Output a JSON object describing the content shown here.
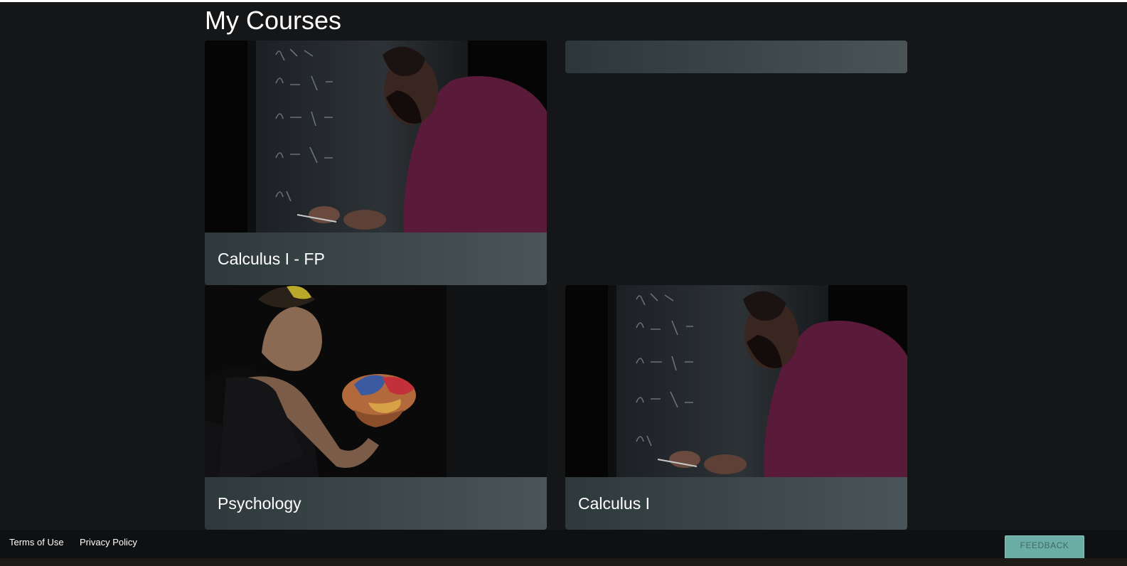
{
  "page": {
    "title": "My Courses"
  },
  "courses": [
    {
      "title": "Calculus I - FP",
      "image": "math-chalkboard-instructor"
    },
    {
      "title": "Psychology",
      "image": "student-holding-brain-model"
    },
    {
      "title": "Calculus I",
      "image": "math-chalkboard-instructor"
    }
  ],
  "footer": {
    "terms_label": "Terms of Use",
    "privacy_label": "Privacy Policy",
    "feedback_label": "FEEDBACK"
  },
  "colors": {
    "background": "#151618",
    "card_footer_start": "#2e393c",
    "card_footer_end": "#4a5558",
    "feedback_accent": "#6aaea6"
  }
}
